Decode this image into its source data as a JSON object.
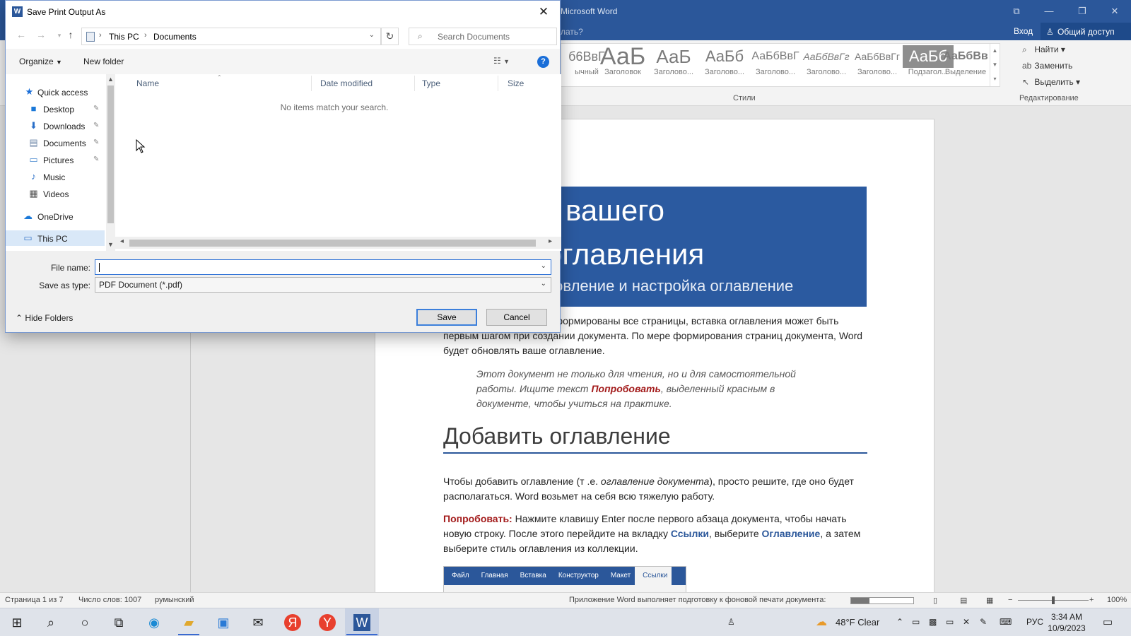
{
  "word": {
    "title": "Microsoft Word",
    "tell_me": "лать?",
    "sign_in": "Вход",
    "share": "Общий доступ",
    "styles": [
      {
        "sample": "б6ВвГ",
        "name": "ычный"
      },
      {
        "sample": "АаБ",
        "name": "Заголовок"
      },
      {
        "sample": "АаБ",
        "name": "Заголово..."
      },
      {
        "sample": "АаБб",
        "name": "Заголово..."
      },
      {
        "sample": "АаБбВвГ",
        "name": "Заголово..."
      },
      {
        "sample": "АаБбВвГг",
        "name": "Заголово..."
      },
      {
        "sample": "АаБбВвГг",
        "name": "Заголово..."
      },
      {
        "sample": "АаБб",
        "name": "Подзагол..."
      },
      {
        "sample": "АаБбВв",
        "name": "Выделение"
      }
    ],
    "styles_group": "Стили",
    "editing_group": "Редактирование",
    "find": "Найти",
    "replace": "Заменить",
    "select": "Выделить",
    "doc": {
      "title_line1": "вашего",
      "title_line2": "оглавления",
      "title_line3": "новление и настройка оглавление",
      "p1": "ка будут окончательно сформированы все страницы, вставка оглавления может быть первым шагом при создании документа. По мере формирования страниц документа, Word будет обновлять ваше оглавление.",
      "italic_a": "Этот документ не только для чтения, но и для самостоятельной работы. Ищите текст ",
      "italic_try": "Попробовать",
      "italic_b": ", выделенный красным в документе, чтобы учиться на практике.",
      "heading": "Добавить оглавление",
      "p2_a": "Чтобы добавить оглавление (т .е. ",
      "p2_ital": "оглавление документа",
      "p2_b": "), просто решите, где оно будет располагаться. Word возьмет на себя всю тяжелую работу.",
      "p3_try": "Попробовать:",
      "p3_a": " Нажмите клавишу Enter после первого абзаца документа, чтобы начать новую строку. После этого перейдите на вкладку ",
      "p3_links": "Ссылки",
      "p3_b": ", выберите ",
      "p3_toc": "Оглавление",
      "p3_c": ", а затем выберите стиль оглавления из коллекции.",
      "mini_tabs": [
        "Файл",
        "Главная",
        "Вставка",
        "Конструктор",
        "Макет",
        "Ссылки"
      ]
    },
    "status": {
      "page": "Страница 1 из 7",
      "words": "Число слов: 1007",
      "lang": "румынский",
      "printing": "Приложение Word выполняет подготовку к фоновой печати документа:",
      "print_progress": 0.3,
      "zoom": "100%"
    }
  },
  "dialog": {
    "title": "Save Print Output As",
    "breadcrumb": [
      "This PC",
      "Documents"
    ],
    "search_placeholder": "Search Documents",
    "organize": "Organize",
    "new_folder": "New folder",
    "tree": [
      {
        "label": "Quick access",
        "icon": "star-icon",
        "pinned": false
      },
      {
        "label": "Desktop",
        "icon": "desktop-icon",
        "pinned": true
      },
      {
        "label": "Downloads",
        "icon": "download-icon",
        "pinned": true
      },
      {
        "label": "Documents",
        "icon": "document-icon",
        "pinned": true
      },
      {
        "label": "Pictures",
        "icon": "pictures-icon",
        "pinned": true
      },
      {
        "label": "Music",
        "icon": "music-icon",
        "pinned": false
      },
      {
        "label": "Videos",
        "icon": "video-icon",
        "pinned": false
      },
      {
        "label": "OneDrive",
        "icon": "cloud-icon",
        "pinned": false
      },
      {
        "label": "This PC",
        "icon": "computer-icon",
        "pinned": false
      }
    ],
    "columns": [
      "Name",
      "Date modified",
      "Type",
      "Size"
    ],
    "empty_message": "No items match your search.",
    "file_name_label": "File name:",
    "file_name_value": "",
    "save_type_label": "Save as type:",
    "save_type_value": "PDF Document (*.pdf)",
    "hide_folders": "Hide Folders",
    "save": "Save",
    "cancel": "Cancel"
  },
  "taskbar": {
    "weather": "48°F  Clear",
    "lang": "РУС",
    "time": "3:34 AM",
    "date": "10/9/2023"
  },
  "colors": {
    "word_blue": "#2b579a",
    "dialog_accent": "#3c7fdb"
  }
}
